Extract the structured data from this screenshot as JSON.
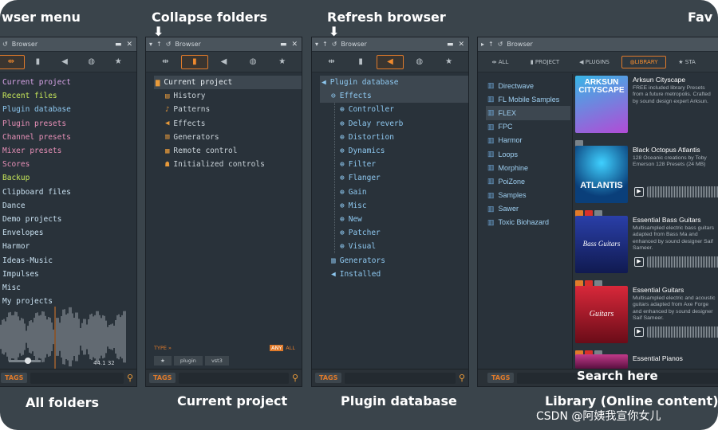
{
  "annotations": {
    "top": [
      "wser menu",
      "Collapse folders",
      "Refresh browser",
      "Fav"
    ],
    "bottom": [
      "All folders",
      "Current project",
      "Plugin database",
      "Library (Online content)"
    ],
    "search_here": "Search here",
    "watermark": "CSDN @阿姨我宣你女儿"
  },
  "panel1": {
    "title": "Browser",
    "items": [
      {
        "label": "Current project",
        "color": "#d8a4e8"
      },
      {
        "label": "Recent files",
        "color": "#c8e85a"
      },
      {
        "label": "Plugin database",
        "color": "#8ec8f0"
      },
      {
        "label": "Plugin presets",
        "color": "#e890b8"
      },
      {
        "label": "Channel presets",
        "color": "#e890b8"
      },
      {
        "label": "Mixer presets",
        "color": "#e890b8"
      },
      {
        "label": "Scores",
        "color": "#e890b8"
      },
      {
        "label": "Backup",
        "color": "#c8e85a"
      },
      {
        "label": "Clipboard files",
        "color": "#c8e0f0"
      },
      {
        "label": "Dance",
        "color": "#c8e0f0"
      },
      {
        "label": "Demo projects",
        "color": "#c8e0f0"
      },
      {
        "label": "Envelopes",
        "color": "#c8e0f0"
      },
      {
        "label": "Harmor",
        "color": "#c8e0f0"
      },
      {
        "label": "Ideas-Music",
        "color": "#c8e0f0"
      },
      {
        "label": "Impulses",
        "color": "#c8e0f0"
      },
      {
        "label": "Misc",
        "color": "#c8e0f0"
      },
      {
        "label": "My projects",
        "color": "#c8e0f0"
      }
    ],
    "sample_info": "44.1",
    "sample_info2": "32",
    "tags_label": "TAGS"
  },
  "panel2": {
    "title": "Browser",
    "header": "Current project",
    "items": [
      "History",
      "Patterns",
      "Effects",
      "Generators",
      "Remote control",
      "Initialized controls"
    ],
    "type_label": "TYPE »",
    "any_label": "ANY",
    "all_label": "ALL",
    "filter_tags": [
      "plugin",
      "vst3"
    ],
    "tags_label": "TAGS"
  },
  "panel3": {
    "title": "Browser",
    "header": "Plugin database",
    "effects_label": "Effects",
    "effects_items": [
      "Controller",
      "Delay reverb",
      "Distortion",
      "Dynamics",
      "Filter",
      "Flanger",
      "Gain",
      "Misc",
      "New",
      "Patcher",
      "Visual"
    ],
    "generators_label": "Generators",
    "installed_label": "Installed",
    "tags_label": "TAGS"
  },
  "panel4": {
    "title": "Browser",
    "tabs": [
      "ALL",
      "PROJECT",
      "PLUGINS",
      "LIBRARY",
      "STA"
    ],
    "folders": [
      "Directwave",
      "FL Mobile Samples",
      "FLEX",
      "FPC",
      "Harmor",
      "Loops",
      "Morphine",
      "PoiZone",
      "Samples",
      "Sawer",
      "Toxic Biohazard"
    ],
    "cards": [
      {
        "title": "Arksun Cityscape",
        "desc": "FREE included library Presets from a future metropolis. Crafted by sound design expert Arksun.",
        "art": "ARKSUN CITYSCAPE"
      },
      {
        "title": "Black Octopus Atlantis",
        "desc": "128 Oceanic creations by Toby Emerson 128 Presets (24 MB)",
        "art": "ATLANTIS"
      },
      {
        "title": "Essential Bass Guitars",
        "desc": "Multisampled electric bass guitars adapted from Bass Ma and enhanced by sound designer Saif Sameer.",
        "art": "Bass Guitars"
      },
      {
        "title": "Essential Guitars",
        "desc": "Multisampled electric and acoustic guitars adapted from Axe Forge and enhanced by sound designer Saif Sameer.",
        "art": "Guitars"
      },
      {
        "title": "Essential Pianos",
        "desc": "",
        "art": ""
      }
    ],
    "tags_label": "TAGS"
  }
}
